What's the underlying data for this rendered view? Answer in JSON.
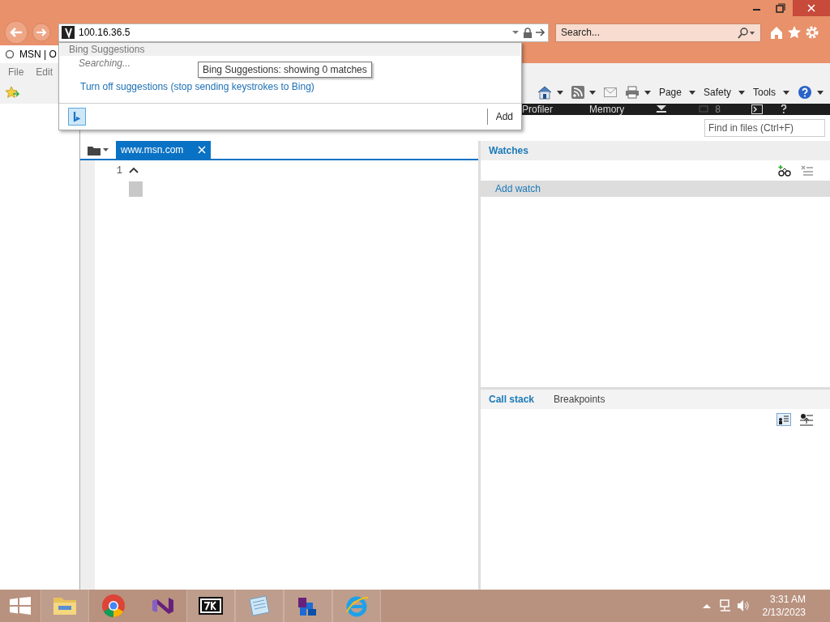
{
  "browser": {
    "address": "100.16.36.5",
    "search_placeholder": "Search...",
    "tab_title": "MSN | O",
    "menu": [
      "File",
      "Edit"
    ],
    "command_bar": [
      {
        "kind": "home"
      },
      {
        "kind": "feeds"
      },
      {
        "kind": "mail"
      },
      {
        "kind": "print"
      },
      {
        "kind": "menu",
        "label": "Page"
      },
      {
        "kind": "menu",
        "label": "Safety"
      },
      {
        "kind": "menu",
        "label": "Tools"
      },
      {
        "kind": "help"
      }
    ]
  },
  "suggestions": {
    "header": "Bing Suggestions",
    "status": "Searching...",
    "tooltip": "Bing Suggestions: showing 0 matches",
    "link": "Turn off suggestions (stop sending keystrokes to Bing)",
    "add_button": "Add"
  },
  "devtools": {
    "tabs": [
      "Profiler",
      "Memory"
    ],
    "error_count": "8",
    "find_placeholder": "Find in files (Ctrl+F)",
    "editor": {
      "tab": "www.msn.com",
      "line_numbers": [
        "1"
      ]
    },
    "watches": {
      "title": "Watches",
      "add_watch": "Add watch"
    },
    "bottom_tabs": [
      {
        "label": "Call stack",
        "selected": true
      },
      {
        "label": "Breakpoints",
        "selected": false
      }
    ]
  },
  "taskbar": {
    "apps": [
      {
        "kind": "folder"
      },
      {
        "kind": "chrome"
      },
      {
        "kind": "vs"
      },
      {
        "kind": "zip"
      },
      {
        "kind": "notepad"
      },
      {
        "kind": "net"
      },
      {
        "kind": "ie"
      }
    ],
    "time": "3:31 AM",
    "date": "2/13/2023"
  }
}
